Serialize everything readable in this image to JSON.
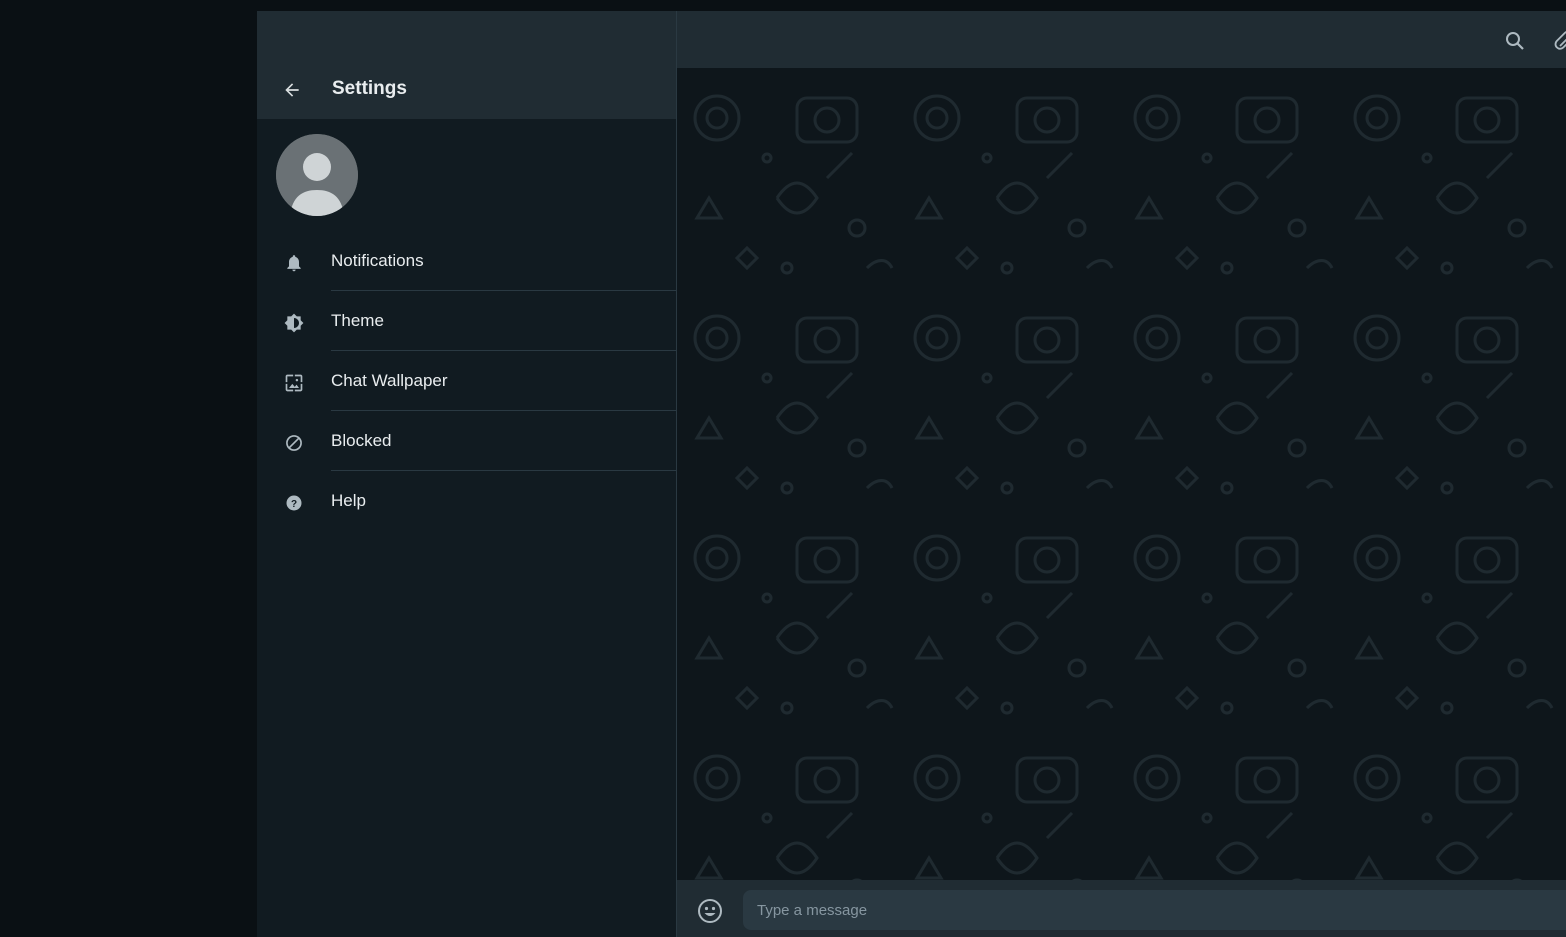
{
  "settings": {
    "title": "Settings",
    "back_icon": "arrow-left-icon",
    "avatar_icon": "default-user-avatar",
    "items": [
      {
        "label": "Notifications",
        "icon": "bell-icon"
      },
      {
        "label": "Theme",
        "icon": "theme-brightness-icon"
      },
      {
        "label": "Chat Wallpaper",
        "icon": "wallpaper-icon"
      },
      {
        "label": "Blocked",
        "icon": "blocked-icon"
      },
      {
        "label": "Help",
        "icon": "help-icon"
      }
    ]
  },
  "chat": {
    "header_icons": [
      "search-icon",
      "paperclip-icon"
    ],
    "composer": {
      "placeholder": "Type a message",
      "emoji_icon": "emoji-icon"
    }
  },
  "colors": {
    "panel_bg": "#111b21",
    "header_bg": "#202c33",
    "text_primary": "#e9edef",
    "icon_gray": "#aebac1",
    "input_bg": "#2a3942"
  }
}
